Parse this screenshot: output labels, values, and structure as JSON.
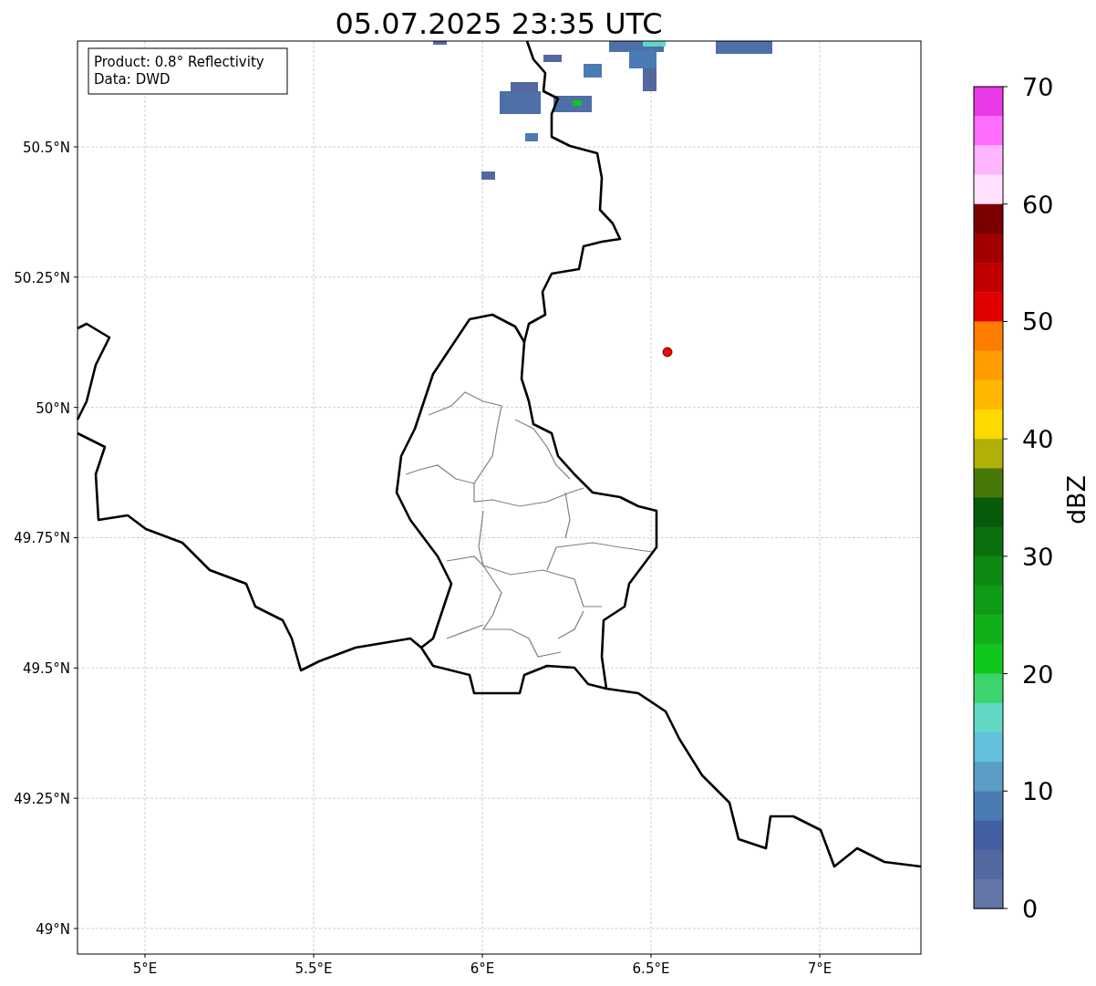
{
  "title": "05.07.2025 23:35 UTC",
  "info_box": [
    "Product: 0.8° Reflectivity",
    "Data: DWD"
  ],
  "map": {
    "x_ticks": [
      "5°E",
      "5.5°E",
      "6°E",
      "6.5°E",
      "7°E"
    ],
    "y_ticks": [
      "50.5°N",
      "50.25°N",
      "50°N",
      "49.75°N",
      "49.5°N",
      "49.25°N",
      "49°N"
    ]
  },
  "colorbar": {
    "label": "dBZ",
    "ticks": [
      "70",
      "60",
      "50",
      "40",
      "30",
      "20",
      "10",
      "0"
    ],
    "bands": [
      {
        "color": "#e838e8"
      },
      {
        "color": "#ff6cff"
      },
      {
        "color": "#ffb4ff"
      },
      {
        "color": "#ffe0ff"
      },
      {
        "color": "#7a0000"
      },
      {
        "color": "#a00000"
      },
      {
        "color": "#c00000"
      },
      {
        "color": "#e00000"
      },
      {
        "color": "#ff7c00"
      },
      {
        "color": "#ff9c00"
      },
      {
        "color": "#ffb800"
      },
      {
        "color": "#ffd800"
      },
      {
        "color": "#b0b008"
      },
      {
        "color": "#487808"
      },
      {
        "color": "#065a0a"
      },
      {
        "color": "#0a700e"
      },
      {
        "color": "#0c8a14"
      },
      {
        "color": "#0e9c16"
      },
      {
        "color": "#10b01a"
      },
      {
        "color": "#10c81c"
      },
      {
        "color": "#3cd46c"
      },
      {
        "color": "#60d8c4"
      },
      {
        "color": "#64c0dc"
      },
      {
        "color": "#5a9ec6"
      },
      {
        "color": "#4a7bb2"
      },
      {
        "color": "#425fa3"
      },
      {
        "color": "#5468a0"
      },
      {
        "color": "#6475a8"
      }
    ]
  }
}
